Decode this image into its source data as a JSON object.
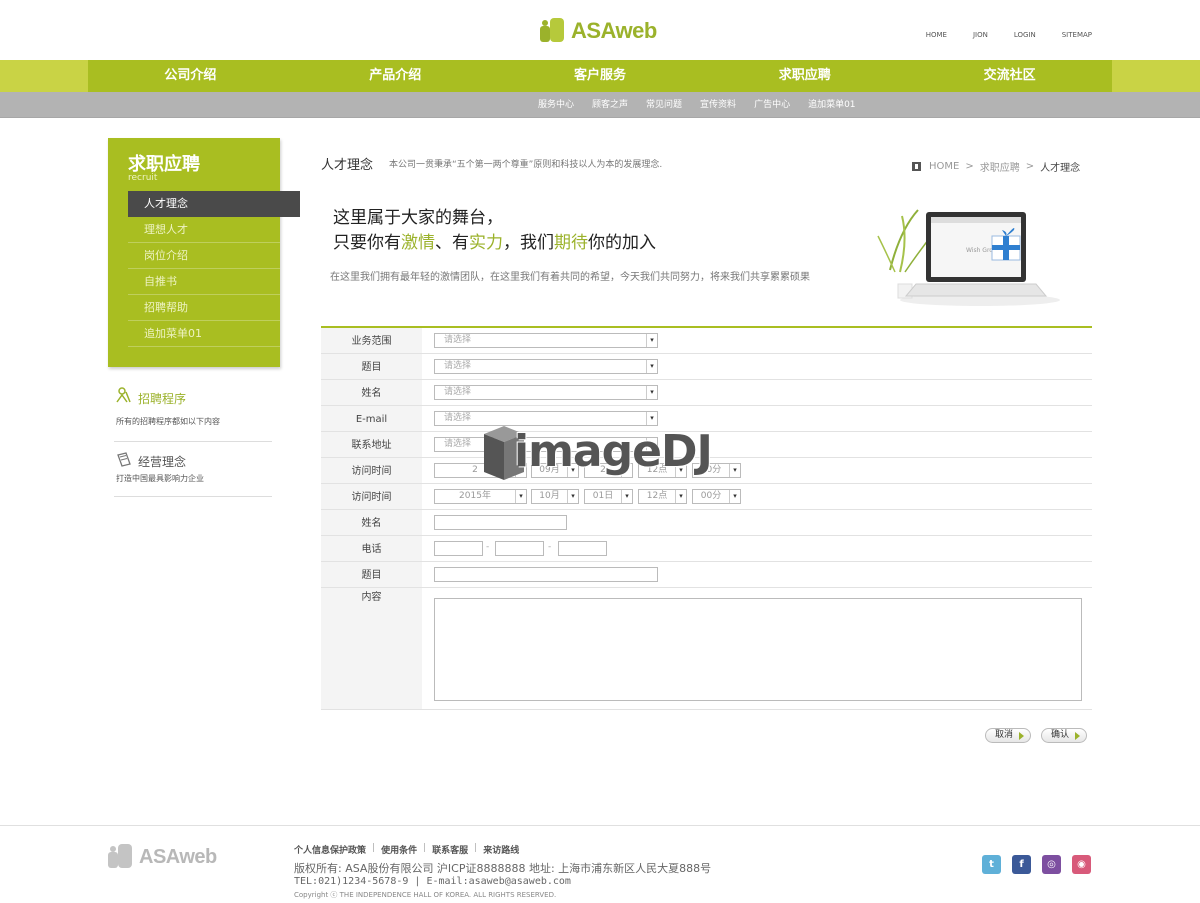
{
  "brand": {
    "logo_text": "ASAweb"
  },
  "top_links": [
    "HOME",
    "JION",
    "LOGIN",
    "SITEMAP"
  ],
  "main_nav": [
    "公司介绍",
    "产品介绍",
    "客户服务",
    "求职应聘",
    "交流社区"
  ],
  "sub_nav": [
    "服务中心",
    "顾客之声",
    "常见问题",
    "宣传资料",
    "广告中心",
    "追加菜单01"
  ],
  "sidebar": {
    "title": "求职应聘",
    "subtitle": "recruit",
    "items": [
      "人才理念",
      "理想人才",
      "岗位介绍",
      "自推书",
      "招聘帮助",
      "追加菜单01"
    ],
    "section1": {
      "title": "招聘程序",
      "desc": "所有的招聘程序都如以下内容"
    },
    "section2": {
      "title": "经营理念",
      "desc": "打造中国最具影响力企业"
    }
  },
  "page": {
    "title": "人才理念",
    "desc": "本公司一贯秉承“五个第一两个尊重”原则和科技以人为本的发展理念.",
    "breadcrumb": [
      "HOME",
      ">",
      "求职应聘",
      ">",
      "人才理念"
    ]
  },
  "banner": {
    "line1": "这里属于大家的舞台，",
    "line2": [
      "只要你有",
      "激情",
      "、有",
      "实力",
      "，我们",
      "期待",
      "你的加入"
    ],
    "desc": "在这里我们拥有最年轻的激情团队，在这里我们有着共同的希望，今天我们共同努力，将来我们共享累累硕果",
    "screen_text": "Wish Gro"
  },
  "form": {
    "rows": [
      {
        "label": "业务范围",
        "placeholder": "请选择"
      },
      {
        "label": "题目",
        "placeholder": "请选择"
      },
      {
        "label": "姓名",
        "placeholder": "请选择"
      },
      {
        "label": "E-mail",
        "placeholder": "请选择"
      },
      {
        "label": "联系地址",
        "placeholder": "请选择"
      }
    ],
    "visit1": {
      "label": "访问时间",
      "year": "2",
      "month": "09月",
      "day": "2",
      "hour": "12点",
      "minute": "00分"
    },
    "visit2": {
      "label": "访问时间",
      "year": "2015年",
      "month": "10月",
      "day": "01日",
      "hour": "12点",
      "minute": "00分"
    },
    "name_label": "姓名",
    "phone_label": "电话",
    "phone_dash": "-",
    "subject_label": "题目",
    "content_label": "内容",
    "arrow": "▾"
  },
  "buttons": {
    "cancel": "取消",
    "confirm": "确认"
  },
  "watermark": "imageDJ",
  "footer": {
    "logo_text": "ASAweb",
    "links": [
      "个人信息保护政策",
      "使用条件",
      "联系客服",
      "来访路线"
    ],
    "sep": "|",
    "copyright": "版权所有: ASA股份有限公司 沪ICP证8888888 地址: 上海市浦东新区人民大夏888号",
    "contact": "TEL:021)1234-5678-9 | E-mail:asaweb@asaweb.com",
    "small": "Copyright ⓒ THE INDEPENDENCE HALL OF KOREA. ALL RIGHTS RESERVED.",
    "social": [
      "twitter-icon",
      "facebook-icon",
      "instagram-icon",
      "weibo-icon"
    ]
  },
  "colors": {
    "accent": "#a9be21",
    "accent_light": "#c9d345",
    "subnav": "#b3b3b3"
  }
}
